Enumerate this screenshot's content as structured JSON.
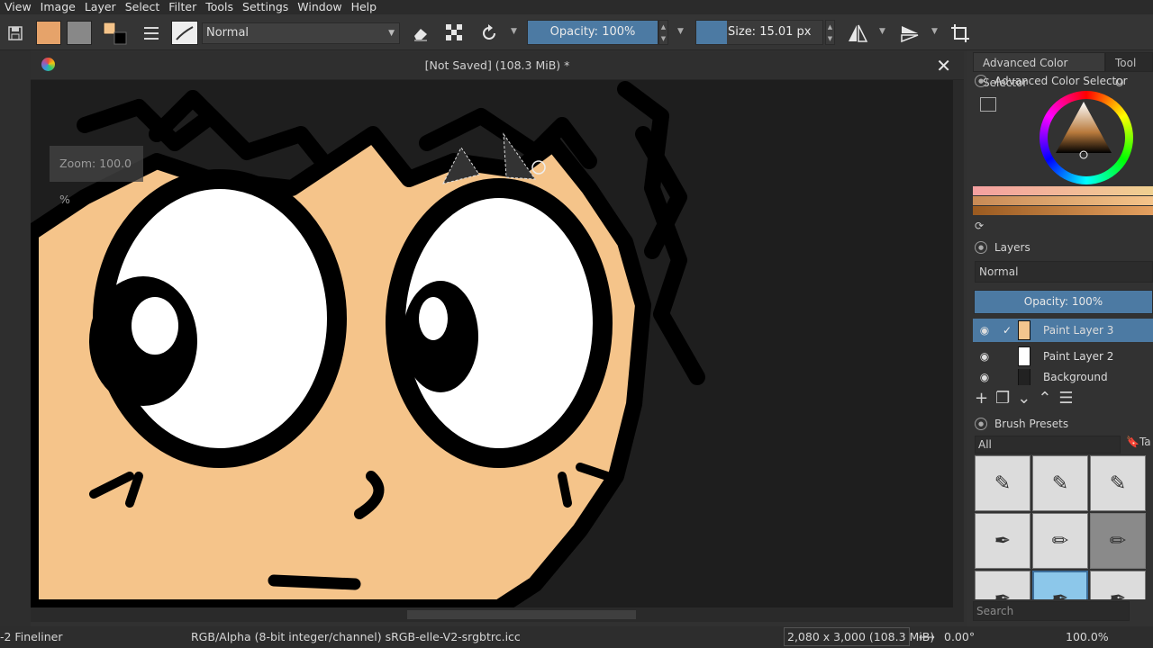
{
  "menu": [
    "View",
    "Image",
    "Layer",
    "Select",
    "Filter",
    "Tools",
    "Settings",
    "Window",
    "Help"
  ],
  "toolbar": {
    "blend_mode": "Normal",
    "opacity": "Opacity: 100%",
    "size": "Size: 15.01 px"
  },
  "document": {
    "title": "[Not Saved]  (108.3 MiB) *",
    "zoom_tooltip": "Zoom: 100.0 %"
  },
  "dock": {
    "tabs": [
      "Advanced Color Selector",
      "Tool O"
    ],
    "color_selector_title": "Advanced Color Selector",
    "layers_title": "Layers",
    "layers_blend": "Normal",
    "layers_opacity": "Opacity:  100%",
    "layers": [
      {
        "name": "Paint Layer 3",
        "selected": true
      },
      {
        "name": "Paint Layer 2",
        "selected": false
      },
      {
        "name": "Background",
        "selected": false
      }
    ],
    "brush_presets_title": "Brush Presets",
    "brush_filter": "All",
    "brush_tag": "Ta",
    "search_placeholder": "Search"
  },
  "status": {
    "brush": "-2 Fineliner",
    "color_space": "RGB/Alpha (8-bit integer/channel)  sRGB-elle-V2-srgbtrc.icc",
    "dimensions": "2,080 x 3,000 (108.3 MiB)",
    "rotation": "0.00°",
    "zoom": "100.0%"
  },
  "colors": {
    "skin": "#f5c48a",
    "outline": "#000000",
    "canvas_bg": "#1e1e1e",
    "accent": "#4c7aa3"
  }
}
